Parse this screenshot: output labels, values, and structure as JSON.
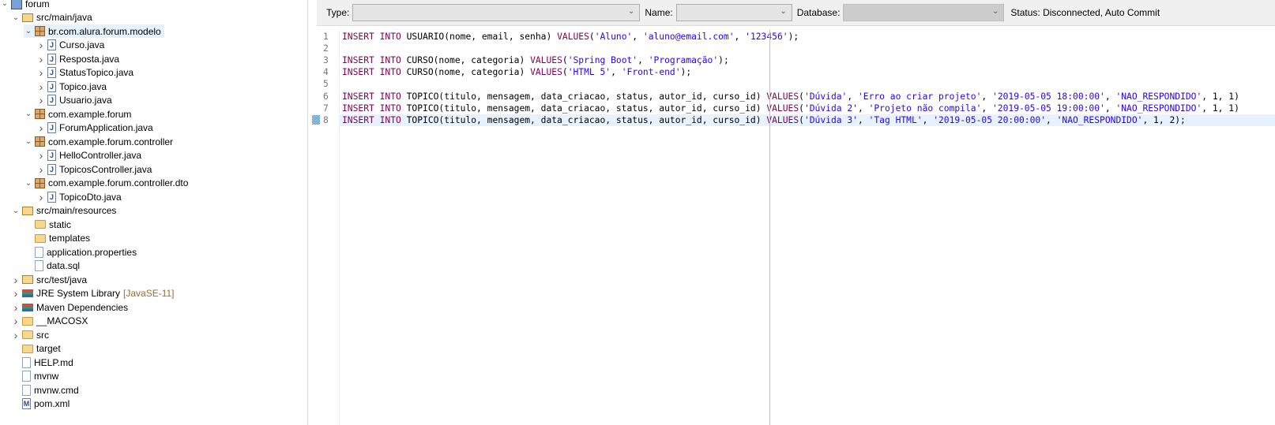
{
  "tree": [
    {
      "label": "forum",
      "level": 0,
      "chev": "open",
      "icon": "project-icon"
    },
    {
      "label": "src/main/java",
      "level": 1,
      "chev": "open",
      "icon": "source-folder-icon"
    },
    {
      "label": "br.com.alura.forum.modelo",
      "level": 2,
      "chev": "open",
      "icon": "package-icon",
      "selected": true
    },
    {
      "label": "Curso.java",
      "level": 3,
      "chev": "closed",
      "icon": "java-file-icon"
    },
    {
      "label": "Resposta.java",
      "level": 3,
      "chev": "closed",
      "icon": "java-file-icon"
    },
    {
      "label": "StatusTopico.java",
      "level": 3,
      "chev": "closed",
      "icon": "java-enum-file-icon"
    },
    {
      "label": "Topico.java",
      "level": 3,
      "chev": "closed",
      "icon": "java-file-icon"
    },
    {
      "label": "Usuario.java",
      "level": 3,
      "chev": "closed",
      "icon": "java-file-icon"
    },
    {
      "label": "com.example.forum",
      "level": 2,
      "chev": "open",
      "icon": "package-icon"
    },
    {
      "label": "ForumApplication.java",
      "level": 3,
      "chev": "closed",
      "icon": "java-file-icon"
    },
    {
      "label": "com.example.forum.controller",
      "level": 2,
      "chev": "open",
      "icon": "package-icon"
    },
    {
      "label": "HelloController.java",
      "level": 3,
      "chev": "closed",
      "icon": "java-file-icon"
    },
    {
      "label": "TopicosController.java",
      "level": 3,
      "chev": "closed",
      "icon": "java-file-icon"
    },
    {
      "label": "com.example.forum.controller.dto",
      "level": 2,
      "chev": "open",
      "icon": "package-icon"
    },
    {
      "label": "TopicoDto.java",
      "level": 3,
      "chev": "closed",
      "icon": "java-file-icon"
    },
    {
      "label": "src/main/resources",
      "level": 1,
      "chev": "open",
      "icon": "source-folder-icon"
    },
    {
      "label": "static",
      "level": 2,
      "chev": "none",
      "icon": "folder-icon"
    },
    {
      "label": "templates",
      "level": 2,
      "chev": "none",
      "icon": "folder-icon"
    },
    {
      "label": "application.properties",
      "level": 2,
      "chev": "none",
      "icon": "text-file-icon"
    },
    {
      "label": "data.sql",
      "level": 2,
      "chev": "none",
      "icon": "sql-file-icon"
    },
    {
      "label": "src/test/java",
      "level": 1,
      "chev": "closed",
      "icon": "source-folder-icon"
    },
    {
      "label": "JRE System Library",
      "level": 1,
      "chev": "closed",
      "icon": "library-icon",
      "decoration": "[JavaSE-11]"
    },
    {
      "label": "Maven Dependencies",
      "level": 1,
      "chev": "closed",
      "icon": "library-icon"
    },
    {
      "label": "__MACOSX",
      "level": 1,
      "chev": "closed",
      "icon": "folder-icon"
    },
    {
      "label": "src",
      "level": 1,
      "chev": "closed",
      "icon": "folder-icon"
    },
    {
      "label": "target",
      "level": 1,
      "chev": "none",
      "icon": "folder-icon"
    },
    {
      "label": "HELP.md",
      "level": 1,
      "chev": "none",
      "icon": "word-file-icon"
    },
    {
      "label": "mvnw",
      "level": 1,
      "chev": "none",
      "icon": "text-file-icon"
    },
    {
      "label": "mvnw.cmd",
      "level": 1,
      "chev": "none",
      "icon": "script-file-icon"
    },
    {
      "label": "pom.xml",
      "level": 1,
      "chev": "none",
      "icon": "maven-pom-icon"
    }
  ],
  "toolbar": {
    "type_label": "Type:",
    "type_value": "",
    "name_label": "Name:",
    "name_value": "",
    "database_label": "Database:",
    "database_value": "",
    "status": "Status:  Disconnected, Auto Commit"
  },
  "editor": {
    "current_line": 8,
    "lines": [
      [
        [
          "kw",
          "INSERT INTO "
        ],
        [
          "t",
          "USUARIO(nome, email, senha) "
        ],
        [
          "kw",
          "VALUES"
        ],
        [
          "t",
          "("
        ],
        [
          "str",
          "'Aluno'"
        ],
        [
          "t",
          ", "
        ],
        [
          "str",
          "'aluno@email.com'"
        ],
        [
          "t",
          ", "
        ],
        [
          "str",
          "'123456'"
        ],
        [
          "t",
          ");"
        ]
      ],
      [],
      [
        [
          "kw",
          "INSERT INTO "
        ],
        [
          "t",
          "CURSO(nome, categoria) "
        ],
        [
          "kw",
          "VALUES"
        ],
        [
          "t",
          "("
        ],
        [
          "str",
          "'Spring Boot'"
        ],
        [
          "t",
          ", "
        ],
        [
          "str",
          "'Programação'"
        ],
        [
          "t",
          ");"
        ]
      ],
      [
        [
          "kw",
          "INSERT INTO "
        ],
        [
          "t",
          "CURSO(nome, categoria) "
        ],
        [
          "kw",
          "VALUES"
        ],
        [
          "t",
          "("
        ],
        [
          "str",
          "'HTML 5'"
        ],
        [
          "t",
          ", "
        ],
        [
          "str",
          "'Front-end'"
        ],
        [
          "t",
          ");"
        ]
      ],
      [],
      [
        [
          "kw",
          "INSERT INTO "
        ],
        [
          "t",
          "TOPICO(titulo, mensagem, data_criacao, status, autor_id, curso_id) "
        ],
        [
          "kw",
          "VALUES"
        ],
        [
          "t",
          "("
        ],
        [
          "str",
          "'Dúvida'"
        ],
        [
          "t",
          ", "
        ],
        [
          "str",
          "'Erro ao criar projeto'"
        ],
        [
          "t",
          ", "
        ],
        [
          "str",
          "'2019-05-05 18:00:00'"
        ],
        [
          "t",
          ", "
        ],
        [
          "str",
          "'NAO_RESPONDIDO'"
        ],
        [
          "t",
          ", 1, 1)"
        ]
      ],
      [
        [
          "kw",
          "INSERT INTO "
        ],
        [
          "t",
          "TOPICO(titulo, mensagem, data_criacao, status, autor_id, curso_id) "
        ],
        [
          "kw",
          "VALUES"
        ],
        [
          "t",
          "("
        ],
        [
          "str",
          "'Dúvida 2'"
        ],
        [
          "t",
          ", "
        ],
        [
          "str",
          "'Projeto não compila'"
        ],
        [
          "t",
          ", "
        ],
        [
          "str",
          "'2019-05-05 19:00:00'"
        ],
        [
          "t",
          ", "
        ],
        [
          "str",
          "'NAO_RESPONDIDO'"
        ],
        [
          "t",
          ", 1, 1)"
        ]
      ],
      [
        [
          "kw",
          "INSERT INTO "
        ],
        [
          "t",
          "TOPICO(titulo, mensagem, data_criacao, status, autor_id, curso_id) "
        ],
        [
          "kw",
          "VALUES"
        ],
        [
          "t",
          "("
        ],
        [
          "str",
          "'Dúvida 3'"
        ],
        [
          "t",
          ", "
        ],
        [
          "str",
          "'Tag HTML'"
        ],
        [
          "t",
          ", "
        ],
        [
          "str",
          "'2019-05-05 20:00:00'"
        ],
        [
          "t",
          ", "
        ],
        [
          "str",
          "'NAO_RESPONDIDO'"
        ],
        [
          "t",
          ", 1, 2);"
        ]
      ]
    ]
  }
}
